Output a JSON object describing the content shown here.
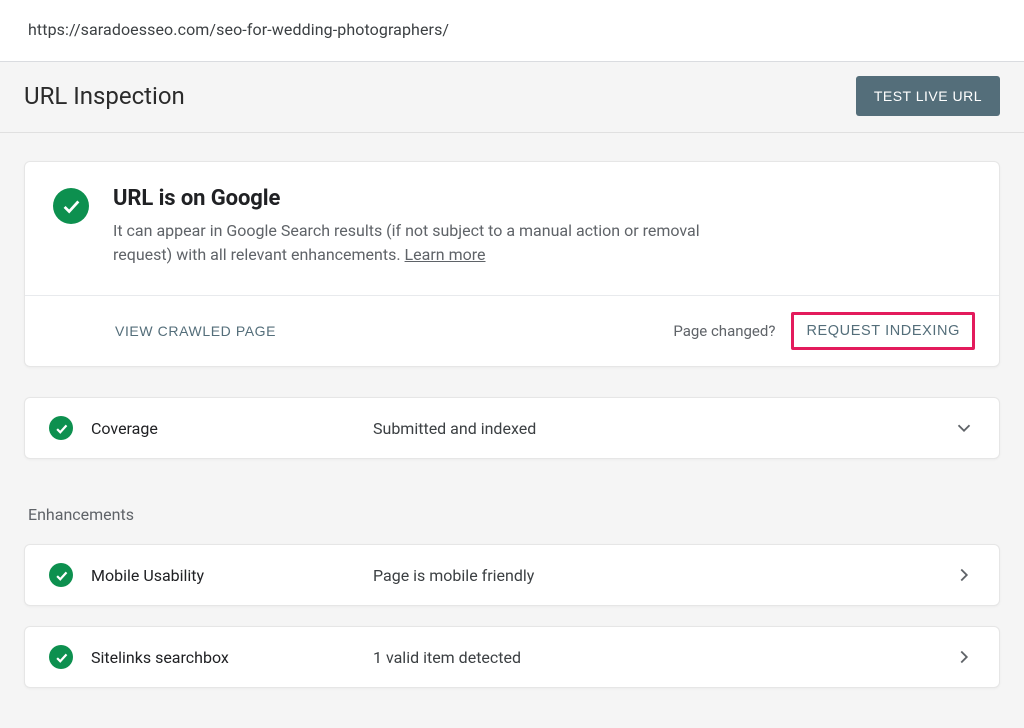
{
  "url": "https://saradoesseo.com/seo-for-wedding-photographers/",
  "page_title": "URL Inspection",
  "buttons": {
    "test_live_url": "TEST LIVE URL",
    "view_crawled_page": "VIEW CRAWLED PAGE",
    "request_indexing": "REQUEST INDEXING"
  },
  "status": {
    "title": "URL is on Google",
    "description_prefix": "It can appear in Google Search results (if not subject to a manual action or removal request) with all relevant enhancements. ",
    "learn_more": "Learn more",
    "page_changed": "Page changed?"
  },
  "coverage": {
    "label": "Coverage",
    "value": "Submitted and indexed"
  },
  "enhancements_label": "Enhancements",
  "enhancements": [
    {
      "label": "Mobile Usability",
      "value": "Page is mobile friendly"
    },
    {
      "label": "Sitelinks searchbox",
      "value": "1 valid item detected"
    }
  ],
  "colors": {
    "success": "#0d904f",
    "link": "#546e7a",
    "highlight": "#e31b5c"
  }
}
